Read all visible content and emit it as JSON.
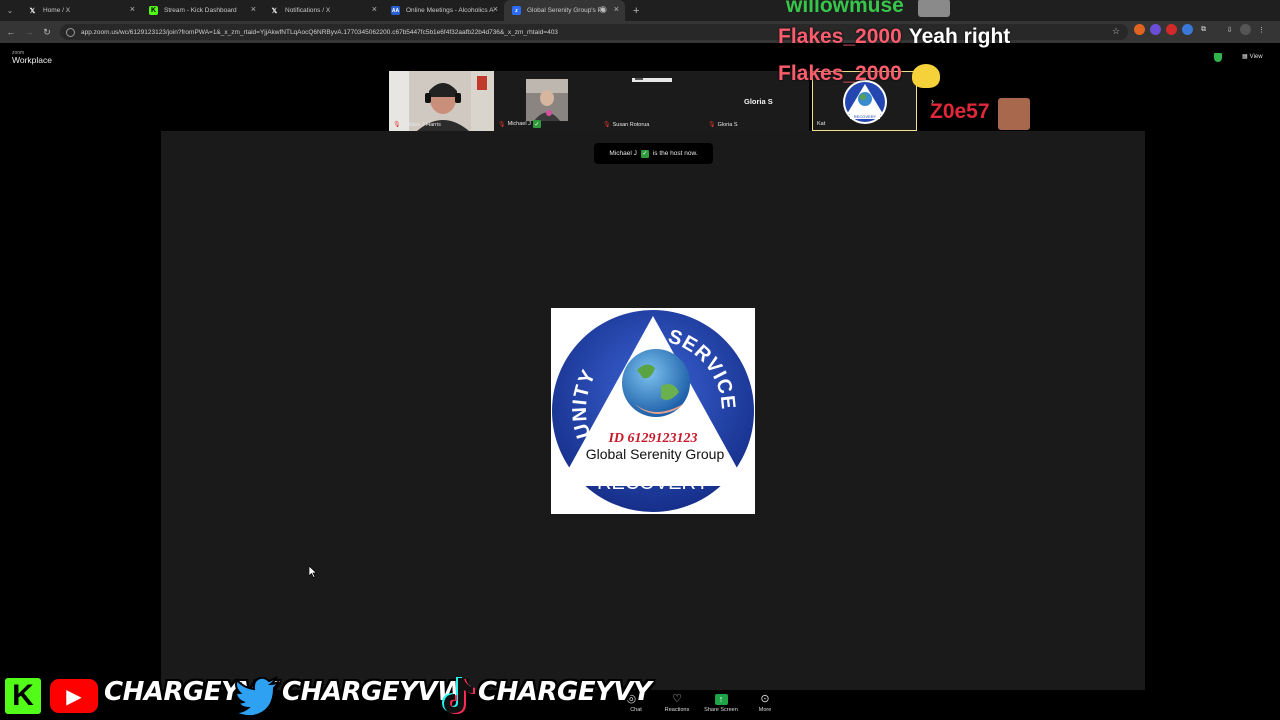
{
  "browser": {
    "tabs": [
      {
        "title": "Home / X",
        "icon": "x-logo-icon",
        "active": false
      },
      {
        "title": "Stream - Kick Dashboard",
        "icon": "kick-logo-icon",
        "active": false
      },
      {
        "title": "Notifications / X",
        "icon": "x-logo-icon",
        "active": false
      },
      {
        "title": "Online Meetings - Alcoholics A",
        "icon": "aa-logo-icon",
        "active": false
      },
      {
        "title": "Global Serenity Group's Pe",
        "icon": "zoom-logo-icon",
        "active": true
      }
    ],
    "url": "app.zoom.us/wc/6129123123/join?fromPWA=1&_x_zm_rtaid=YjjAkwfNTLqAocQ6NRByvA.1770345062200.c67b5447fc5b1e6f4f32aafb22b4d736&_x_zm_rhtaid=403"
  },
  "zoom": {
    "brand_small": "zoom",
    "brand": "Workplace",
    "view_label": "View",
    "toast": {
      "name": "Michael J",
      "suffix": "is the host now."
    },
    "participants": [
      {
        "name": "William J Harris",
        "muted": true
      },
      {
        "name": "Michael J",
        "muted": true,
        "host": true
      },
      {
        "name": "Susan Rotorua",
        "muted": true
      },
      {
        "name": "Gloria S",
        "muted": true,
        "center_name": "Gloria S"
      },
      {
        "name": "Kat",
        "muted": false,
        "active_speaker": true
      }
    ],
    "shared_logo": {
      "word_left": "UNITY",
      "word_right": "SERVICE",
      "id_line": "ID 6129123123",
      "group_name": "Global Serenity Group",
      "bottom_word": "RECOVERY",
      "colors": {
        "blue": "#1f3fa6",
        "red": "#c8182a"
      }
    },
    "toolbar": [
      {
        "label": "Chat",
        "icon": "chat-icon"
      },
      {
        "label": "Reactions",
        "icon": "reactions-icon"
      },
      {
        "label": "Share Screen",
        "icon": "share-screen-icon"
      },
      {
        "label": "More",
        "icon": "more-icon"
      }
    ]
  },
  "overlay": {
    "chat": [
      {
        "user": "willowmuse",
        "message": ""
      },
      {
        "user": "Flakes_2000",
        "message": "Yeah right"
      },
      {
        "user": "Flakes_2000",
        "message": ""
      },
      {
        "user": "Z0e57",
        "message": ""
      }
    ],
    "socials": {
      "youtube": "CHARGEYVY",
      "twitter": "CHARGEYVW",
      "tiktok": "CHARGEYVY"
    }
  }
}
